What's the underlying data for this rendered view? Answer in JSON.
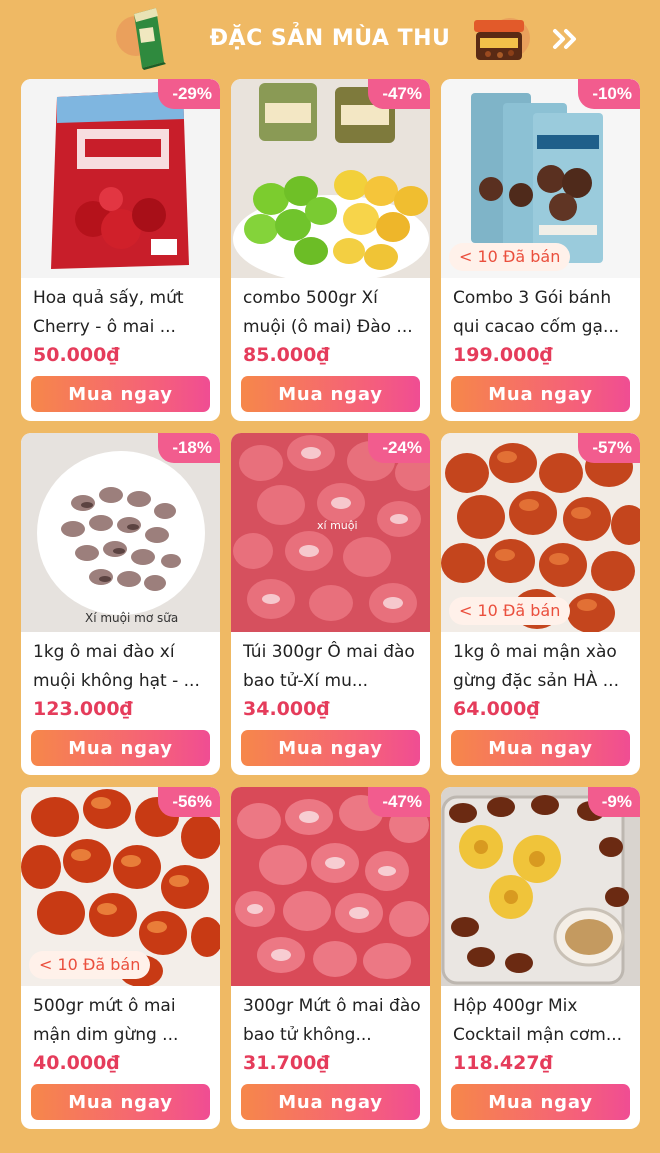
{
  "header": {
    "title": "ĐẶC SẢN MÙA THU",
    "left_decor_icon": "tea-box-icon",
    "right_decor_icon": "food-jar-icon",
    "more_icon": "double-chevron-right-icon"
  },
  "colors": {
    "background": "#efb964",
    "discount_badge": "#f25c8e",
    "price": "#e53c5b",
    "button_gradient": [
      "#f6874a",
      "#f04d93"
    ]
  },
  "products": [
    {
      "discount": "-29%",
      "name": "Hoa quả sấy, mứt Cherry - ô mai ...",
      "price": "50.000₫",
      "button": "Mua ngay",
      "sold": "",
      "image_caption": ""
    },
    {
      "discount": "-47%",
      "name": "combo 500gr Xí muội (ô mai) Đào ...",
      "price": "85.000₫",
      "button": "Mua ngay",
      "sold": "",
      "image_caption": ""
    },
    {
      "discount": "-10%",
      "name": "Combo 3 Gói bánh qui cacao cốm gạ...",
      "price": "199.000₫",
      "button": "Mua ngay",
      "sold": "< 10 Đã bán",
      "image_caption": ""
    },
    {
      "discount": "-18%",
      "name": "1kg ô mai đào xí muội không hạt - ...",
      "price": "123.000₫",
      "button": "Mua ngay",
      "sold": "",
      "image_caption": "Xí muội mơ sữa"
    },
    {
      "discount": "-24%",
      "name": "Túi 300gr Ô mai đào bao tử-Xí mu...",
      "price": "34.000₫",
      "button": "Mua ngay",
      "sold": "",
      "image_caption": "xí muội"
    },
    {
      "discount": "-57%",
      "name": "1kg ô mai mận xào gừng đặc sản HÀ ...",
      "price": "64.000₫",
      "button": "Mua ngay",
      "sold": "< 10 Đã bán",
      "image_caption": ""
    },
    {
      "discount": "-56%",
      "name": "500gr mứt ô mai mận dim gừng ...",
      "price": "40.000₫",
      "button": "Mua ngay",
      "sold": "< 10 Đã bán",
      "image_caption": ""
    },
    {
      "discount": "-47%",
      "name": "300gr Mứt ô mai đào bao tử không...",
      "price": "31.700₫",
      "button": "Mua ngay",
      "sold": "",
      "image_caption": ""
    },
    {
      "discount": "-9%",
      "name": "Hộp 400gr Mix Cocktail mận cơm...",
      "price": "118.427₫",
      "button": "Mua ngay",
      "sold": "",
      "image_caption": ""
    }
  ]
}
